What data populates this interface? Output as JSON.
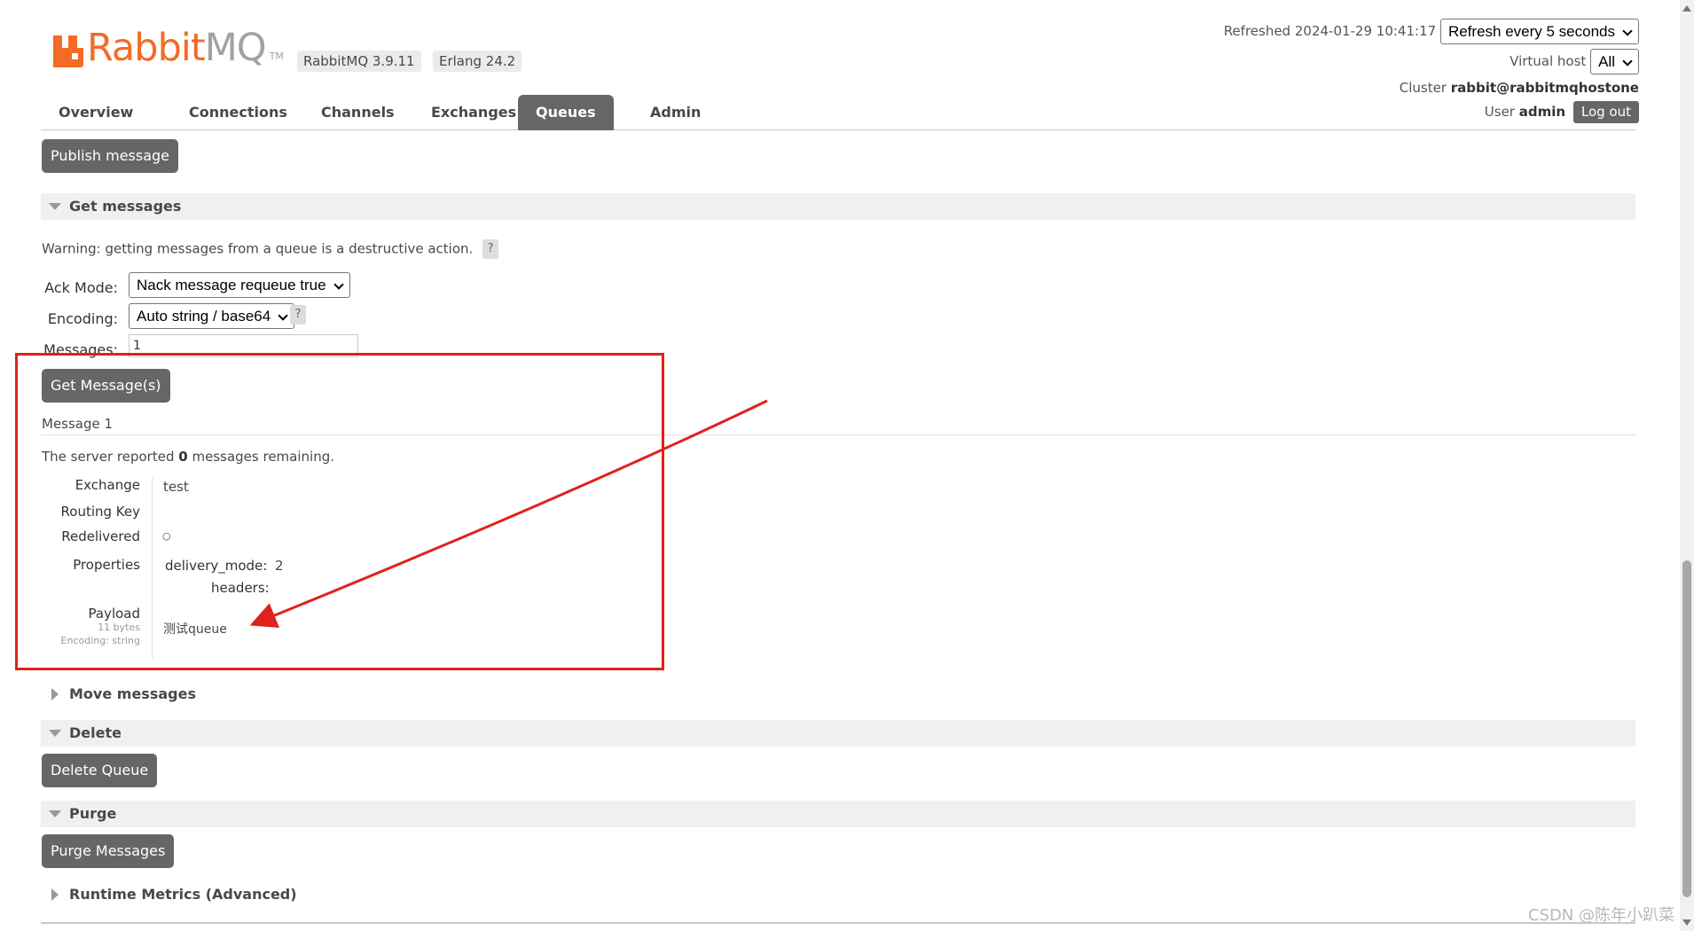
{
  "brand": {
    "name_part1": "Rabbit",
    "name_part2": "MQ",
    "tm": "TM",
    "color": "#f26b27"
  },
  "versions": {
    "rabbitmq": "RabbitMQ 3.9.11",
    "erlang": "Erlang 24.2"
  },
  "header": {
    "refreshed_label": "Refreshed 2024-01-29 10:41:17",
    "refresh_select": "Refresh every 5 seconds",
    "vhost_label": "Virtual host",
    "vhost_select": "All",
    "cluster_label": "Cluster",
    "cluster_name": "rabbit@rabbitmqhostone",
    "user_label": "User",
    "user_name": "admin",
    "logout": "Log out"
  },
  "tabs": [
    {
      "label": "Overview"
    },
    {
      "label": "Connections"
    },
    {
      "label": "Channels"
    },
    {
      "label": "Exchanges"
    },
    {
      "label": "Queues",
      "active": true
    },
    {
      "label": "Admin"
    }
  ],
  "publish_button": "Publish message",
  "get_messages": {
    "title": "Get messages",
    "warning": "Warning: getting messages from a queue is a destructive action.",
    "help": "?",
    "ack_mode_label": "Ack Mode:",
    "ack_mode_value": "Nack message requeue true",
    "encoding_label": "Encoding:",
    "encoding_value": "Auto string / base64",
    "messages_label": "Messages:",
    "messages_value": "1",
    "get_button": "Get Message(s)"
  },
  "message": {
    "heading": "Message 1",
    "remaining_prefix": "The server reported",
    "remaining_count": "0",
    "remaining_suffix": "messages remaining.",
    "exchange_label": "Exchange",
    "exchange_value": "test",
    "routing_key_label": "Routing Key",
    "routing_key_value": "",
    "redelivered_label": "Redelivered",
    "redelivered_value": "○",
    "properties_label": "Properties",
    "delivery_mode_key": "delivery_mode:",
    "delivery_mode_value": "2",
    "headers_key": "headers:",
    "payload_label": "Payload",
    "payload_size": "11 bytes",
    "payload_encoding": "Encoding: string",
    "payload_value": "测试queue"
  },
  "sections": {
    "move": "Move messages",
    "delete": "Delete",
    "delete_button": "Delete Queue",
    "purge": "Purge",
    "purge_button": "Purge Messages",
    "runtime": "Runtime Metrics (Advanced)"
  },
  "watermark": "CSDN @陈年小趴菜",
  "colors": {
    "highlight_box": "#e0211c",
    "button_bg": "#666666",
    "section_bg": "#f0f0f0"
  }
}
